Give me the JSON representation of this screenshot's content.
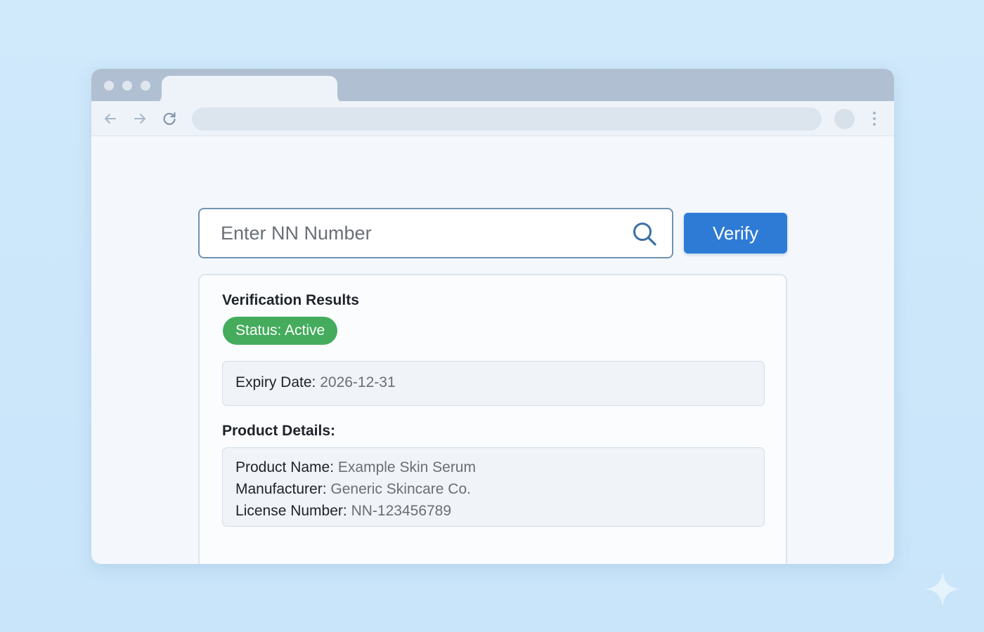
{
  "search": {
    "placeholder": "Enter NN Number",
    "value": "",
    "icon": "search-icon"
  },
  "verify_button": {
    "label": "Verify"
  },
  "results": {
    "title": "Verification Results",
    "status": "Status: Active",
    "status_color": "#44ac5c",
    "expiry": {
      "label": "Expiry Date:",
      "value": "2026-12-31"
    },
    "details_heading": "Product Details:",
    "details": [
      {
        "label": "Product Name:",
        "value": "Example Skin Serum"
      },
      {
        "label": "Manufacturer:",
        "value": "Generic Skincare Co."
      },
      {
        "label": "License Number:",
        "value": "NN-123456789"
      }
    ]
  },
  "browser": {
    "icons": [
      "back-arrow-icon",
      "forward-arrow-icon",
      "reload-icon",
      "menu-dots-icon"
    ]
  },
  "colors": {
    "accent": "#2e7bd6",
    "background": "#cde7fa",
    "status_active": "#44ac5c"
  }
}
